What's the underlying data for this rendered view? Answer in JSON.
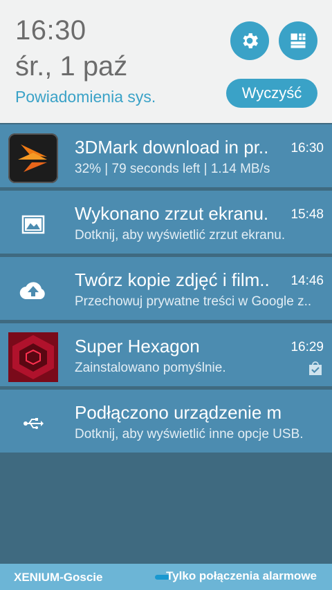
{
  "header": {
    "time": "16:30",
    "date": "śr., 1 paź",
    "section_label": "Powiadomienia sys.",
    "clear_label": "Wyczyść"
  },
  "notifications": [
    {
      "title": "3DMark download in pr..",
      "time": "16:30",
      "text": "32% | 79 seconds left | 1.14 MB/s",
      "icon": "3dmark-app-icon"
    },
    {
      "title": "Wykonano zrzut ekranu.",
      "time": "15:48",
      "text": "Dotknij, aby wyświetlić zrzut ekranu.",
      "icon": "screenshot-icon"
    },
    {
      "title": "Twórz kopie zdjęć i film..",
      "time": "14:46",
      "text": "Przechowuj prywatne treści w Google z..",
      "icon": "cloud-upload-icon"
    },
    {
      "title": "Super Hexagon",
      "time": "16:29",
      "text": "Zainstalowano pomyślnie.",
      "icon": "super-hexagon-app-icon"
    },
    {
      "title": "Podłączono urządzenie multi..",
      "time": "",
      "text": "Dotknij, aby wyświetlić inne opcje USB.",
      "icon": "usb-icon"
    }
  ],
  "status_bar": {
    "network": "XENIUM-Goscie",
    "emergency": "Tylko połączenia alarmowe"
  },
  "colors": {
    "accent": "#3aa2c7",
    "notification_bg": "#4c8cb0",
    "panel_bg": "#3f6a80",
    "header_bg": "#f1f2f2"
  }
}
